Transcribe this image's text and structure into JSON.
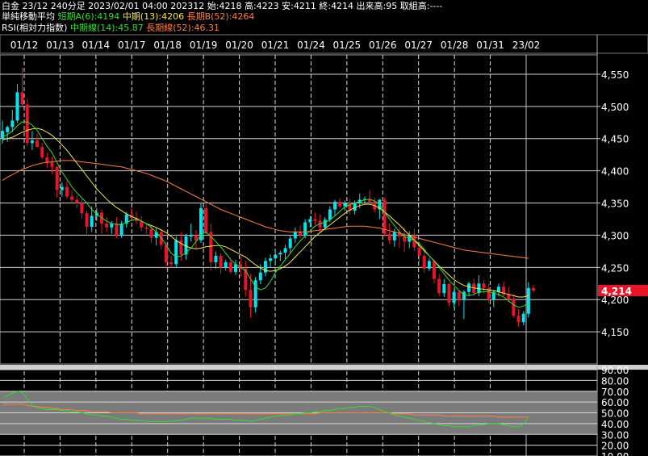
{
  "header": {
    "line1": "白金 23/12 240分足 2023/02/01 04:00 202312 始:4218 高:4223 安:4211 終:4214 出来高:95 取組高:----",
    "ma_title": "単純移動平均",
    "ma_short": "短期A(6):4194",
    "ma_mid": "中期(13):4206",
    "ma_long": "長期B(52):4264",
    "rsi_title": "RSI(相対力指数)",
    "rsi_mid": "中期線(14):45.87",
    "rsi_long": "長期線(52):46.31"
  },
  "colors": {
    "up": "#00e5f0",
    "down": "#e8142a",
    "ma_short": "#33dd33",
    "ma_mid": "#f2e94e",
    "ma_long": "#ff7f45",
    "rsi_mid": "#33dd33",
    "rsi_long": "#ff7f45",
    "price_tag": "#e8142a"
  },
  "chart_data": [
    {
      "type": "candlestick",
      "x_labels": [
        "01/12",
        "01/13",
        "01/14",
        "01/17",
        "01/18",
        "01/19",
        "01/20",
        "01/21",
        "01/24",
        "01/25",
        "01/26",
        "01/27",
        "01/28",
        "01/31",
        "23/02"
      ],
      "ylim": [
        4100,
        4580
      ],
      "y_ticks": [
        4150,
        4200,
        4250,
        4300,
        4350,
        4400,
        4450,
        4500,
        4550
      ],
      "y_tick_labels": [
        "4,150",
        "4,200",
        "4,250",
        "4,300",
        "4,350",
        "4,400",
        "4,450",
        "4,500",
        "4,550"
      ],
      "current_price": 4214,
      "current_price_label": "4,214",
      "candles": [
        [
          4450,
          4478,
          4442,
          4462
        ],
        [
          4460,
          4470,
          4445,
          4468
        ],
        [
          4468,
          4495,
          4460,
          4478
        ],
        [
          4478,
          4535,
          4474,
          4522
        ],
        [
          4522,
          4560,
          4500,
          4503
        ],
        [
          4503,
          4512,
          4438,
          4443
        ],
        [
          4443,
          4462,
          4432,
          4447
        ],
        [
          4447,
          4458,
          4440,
          4437
        ],
        [
          4437,
          4443,
          4418,
          4421
        ],
        [
          4421,
          4428,
          4404,
          4413
        ],
        [
          4413,
          4422,
          4395,
          4406
        ],
        [
          4406,
          4408,
          4358,
          4370
        ],
        [
          4370,
          4382,
          4360,
          4375
        ],
        [
          4375,
          4385,
          4356,
          4360
        ],
        [
          4360,
          4370,
          4350,
          4355
        ],
        [
          4355,
          4362,
          4342,
          4350
        ],
        [
          4350,
          4356,
          4326,
          4334
        ],
        [
          4334,
          4338,
          4300,
          4313
        ],
        [
          4313,
          4345,
          4305,
          4330
        ],
        [
          4330,
          4342,
          4322,
          4335
        ],
        [
          4335,
          4340,
          4302,
          4318
        ],
        [
          4318,
          4328,
          4305,
          4312
        ],
        [
          4312,
          4322,
          4302,
          4318
        ],
        [
          4318,
          4328,
          4295,
          4300
        ],
        [
          4300,
          4322,
          4296,
          4318
        ],
        [
          4318,
          4336,
          4312,
          4332
        ],
        [
          4332,
          4342,
          4322,
          4327
        ],
        [
          4327,
          4337,
          4318,
          4322
        ],
        [
          4322,
          4330,
          4306,
          4312
        ],
        [
          4312,
          4318,
          4302,
          4310
        ],
        [
          4310,
          4315,
          4288,
          4296
        ],
        [
          4296,
          4312,
          4284,
          4305
        ],
        [
          4305,
          4310,
          4278,
          4285
        ],
        [
          4285,
          4290,
          4247,
          4258
        ],
        [
          4258,
          4268,
          4250,
          4255
        ],
        [
          4255,
          4298,
          4250,
          4292
        ],
        [
          4292,
          4305,
          4260,
          4270
        ],
        [
          4270,
          4302,
          4262,
          4298
        ],
        [
          4298,
          4318,
          4290,
          4300
        ],
        [
          4300,
          4308,
          4278,
          4292
        ],
        [
          4292,
          4350,
          4288,
          4342
        ],
        [
          4342,
          4348,
          4300,
          4305
        ],
        [
          4305,
          4318,
          4245,
          4258
        ],
        [
          4258,
          4275,
          4248,
          4268
        ],
        [
          4268,
          4272,
          4240,
          4250
        ],
        [
          4250,
          4262,
          4245,
          4258
        ],
        [
          4258,
          4262,
          4240,
          4243
        ],
        [
          4243,
          4262,
          4238,
          4255
        ],
        [
          4255,
          4268,
          4235,
          4248
        ],
        [
          4248,
          4260,
          4205,
          4215
        ],
        [
          4215,
          4240,
          4172,
          4188
        ],
        [
          4188,
          4235,
          4180,
          4230
        ],
        [
          4230,
          4255,
          4224,
          4242
        ],
        [
          4242,
          4265,
          4236,
          4260
        ],
        [
          4260,
          4270,
          4250,
          4264
        ],
        [
          4264,
          4278,
          4255,
          4270
        ],
        [
          4270,
          4276,
          4260,
          4273
        ],
        [
          4273,
          4285,
          4262,
          4280
        ],
        [
          4280,
          4300,
          4272,
          4295
        ],
        [
          4295,
          4312,
          4288,
          4305
        ],
        [
          4305,
          4315,
          4295,
          4300
        ],
        [
          4300,
          4325,
          4295,
          4320
        ],
        [
          4320,
          4330,
          4312,
          4325
        ],
        [
          4325,
          4335,
          4316,
          4322
        ],
        [
          4322,
          4332,
          4305,
          4312
        ],
        [
          4312,
          4328,
          4308,
          4324
        ],
        [
          4324,
          4345,
          4320,
          4340
        ],
        [
          4340,
          4355,
          4330,
          4352
        ],
        [
          4352,
          4358,
          4342,
          4345
        ],
        [
          4345,
          4354,
          4338,
          4350
        ],
        [
          4350,
          4356,
          4332,
          4338
        ],
        [
          4338,
          4354,
          4332,
          4350
        ],
        [
          4350,
          4365,
          4342,
          4355
        ],
        [
          4355,
          4360,
          4350,
          4356
        ],
        [
          4356,
          4370,
          4350,
          4352
        ],
        [
          4352,
          4358,
          4335,
          4340
        ],
        [
          4340,
          4356,
          4325,
          4355
        ],
        [
          4355,
          4358,
          4298,
          4302
        ],
        [
          4302,
          4318,
          4286,
          4292
        ],
        [
          4292,
          4310,
          4282,
          4305
        ],
        [
          4305,
          4312,
          4280,
          4298
        ],
        [
          4298,
          4312,
          4274,
          4290
        ],
        [
          4290,
          4306,
          4280,
          4300
        ],
        [
          4300,
          4310,
          4275,
          4281
        ],
        [
          4281,
          4290,
          4258,
          4268
        ],
        [
          4268,
          4275,
          4242,
          4248
        ],
        [
          4248,
          4264,
          4244,
          4260
        ],
        [
          4260,
          4262,
          4225,
          4232
        ],
        [
          4232,
          4240,
          4205,
          4210
        ],
        [
          4210,
          4232,
          4204,
          4224
        ],
        [
          4224,
          4226,
          4190,
          4195
        ],
        [
          4195,
          4215,
          4188,
          4212
        ],
        [
          4212,
          4215,
          4190,
          4200
        ],
        [
          4200,
          4215,
          4170,
          4212
        ],
        [
          4212,
          4228,
          4205,
          4225
        ],
        [
          4225,
          4232,
          4206,
          4210
        ],
        [
          4210,
          4238,
          4205,
          4225
        ],
        [
          4225,
          4230,
          4210,
          4218
        ],
        [
          4218,
          4225,
          4195,
          4200
        ],
        [
          4200,
          4215,
          4188,
          4212
        ],
        [
          4212,
          4225,
          4205,
          4220
        ],
        [
          4220,
          4228,
          4205,
          4208
        ],
        [
          4208,
          4220,
          4196,
          4200
        ],
        [
          4200,
          4208,
          4172,
          4175
        ],
        [
          4175,
          4185,
          4158,
          4165
        ],
        [
          4165,
          4182,
          4160,
          4178
        ],
        [
          4178,
          4227,
          4172,
          4218
        ],
        [
          4218,
          4223,
          4211,
          4214
        ]
      ],
      "ma_short": [
        4452,
        4456,
        4462,
        4470,
        4476,
        4476,
        4471,
        4463,
        4450,
        4438,
        4428,
        4413,
        4398,
        4387,
        4375,
        4366,
        4358,
        4350,
        4340,
        4333,
        4327,
        4322,
        4318,
        4317,
        4316,
        4320,
        4323,
        4325,
        4322,
        4318,
        4312,
        4305,
        4296,
        4285,
        4272,
        4266,
        4268,
        4273,
        4280,
        4290,
        4300,
        4305,
        4298,
        4290,
        4282,
        4272,
        4262,
        4255,
        4250,
        4245,
        4232,
        4220,
        4215,
        4218,
        4228,
        4242,
        4252,
        4262,
        4272,
        4282,
        4291,
        4299,
        4307,
        4314,
        4318,
        4320,
        4324,
        4330,
        4337,
        4344,
        4347,
        4350,
        4352,
        4355,
        4356,
        4353,
        4348,
        4336,
        4325,
        4315,
        4305,
        4298,
        4295,
        4292,
        4287,
        4278,
        4268,
        4260,
        4250,
        4240,
        4230,
        4222,
        4214,
        4208,
        4206,
        4208,
        4212,
        4212,
        4212,
        4210,
        4208,
        4204,
        4198,
        4192,
        4188,
        4190,
        4194
      ],
      "ma_mid": [
        4448,
        4450,
        4452,
        4456,
        4460,
        4463,
        4465,
        4466,
        4464,
        4460,
        4455,
        4448,
        4440,
        4432,
        4422,
        4412,
        4402,
        4392,
        4382,
        4372,
        4364,
        4356,
        4349,
        4343,
        4338,
        4333,
        4329,
        4326,
        4322,
        4318,
        4315,
        4312,
        4308,
        4304,
        4298,
        4292,
        4287,
        4283,
        4280,
        4279,
        4280,
        4282,
        4283,
        4284,
        4284,
        4282,
        4278,
        4274,
        4270,
        4266,
        4260,
        4254,
        4249,
        4245,
        4244,
        4245,
        4248,
        4252,
        4258,
        4266,
        4274,
        4282,
        4290,
        4298,
        4304,
        4310,
        4316,
        4322,
        4328,
        4334,
        4339,
        4343,
        4346,
        4348,
        4348,
        4346,
        4342,
        4336,
        4330,
        4323,
        4316,
        4308,
        4300,
        4292,
        4284,
        4276,
        4268,
        4260,
        4252,
        4245,
        4238,
        4231,
        4226,
        4222,
        4220,
        4218,
        4217,
        4216,
        4215,
        4214,
        4212,
        4210,
        4208,
        4206,
        4204,
        4204,
        4206
      ],
      "ma_long": [
        4385,
        4390,
        4394,
        4398,
        4402,
        4405,
        4408,
        4410,
        4412,
        4413,
        4414,
        4415,
        4416,
        4416,
        4416,
        4415,
        4414,
        4413,
        4412,
        4411,
        4410,
        4409,
        4408,
        4407,
        4406,
        4404,
        4402,
        4400,
        4398,
        4396,
        4393,
        4390,
        4387,
        4384,
        4380,
        4376,
        4372,
        4368,
        4364,
        4360,
        4356,
        4352,
        4348,
        4344,
        4340,
        4337,
        4334,
        4331,
        4328,
        4325,
        4322,
        4319,
        4316,
        4313,
        4311,
        4309,
        4307,
        4306,
        4305,
        4305,
        4305,
        4305,
        4306,
        4307,
        4308,
        4309,
        4310,
        4311,
        4312,
        4313,
        4314,
        4314,
        4314,
        4314,
        4313,
        4312,
        4311,
        4309,
        4307,
        4305,
        4303,
        4301,
        4299,
        4297,
        4295,
        4293,
        4291,
        4289,
        4287,
        4285,
        4283,
        4281,
        4279,
        4277,
        4276,
        4275,
        4274,
        4273,
        4272,
        4271,
        4270,
        4269,
        4268,
        4267,
        4266,
        4265,
        4264
      ]
    },
    {
      "type": "line",
      "title": "RSI",
      "ylim": [
        10,
        90
      ],
      "y_ticks": [
        10,
        20,
        30,
        40,
        50,
        60,
        70,
        80,
        90
      ],
      "y_tick_labels": [
        "10.00",
        "20.00",
        "30.00",
        "40.00",
        "50.00",
        "60.00",
        "70.00",
        "80.00",
        "90.00"
      ],
      "series": [
        {
          "name": "中期線(14)",
          "values": [
            64,
            66,
            68,
            70,
            69,
            63,
            57,
            55,
            54,
            53,
            53,
            53,
            52,
            52,
            51,
            51,
            50,
            49,
            48,
            48,
            47,
            47,
            46,
            45,
            44,
            44,
            43,
            43,
            43,
            42,
            42,
            42,
            42,
            42,
            42,
            43,
            43,
            44,
            45,
            45,
            45,
            45,
            45,
            44,
            44,
            44,
            44,
            43,
            43,
            43,
            42,
            43,
            44,
            45,
            46,
            47,
            47,
            48,
            48,
            49,
            49,
            50,
            50,
            51,
            51,
            52,
            52,
            53,
            54,
            54,
            55,
            55,
            56,
            56,
            56,
            55,
            53,
            51,
            50,
            48,
            47,
            46,
            45,
            44,
            43,
            42,
            41,
            40,
            39,
            38,
            38,
            37,
            37,
            37,
            37,
            38,
            39,
            39,
            40,
            40,
            40,
            39,
            38,
            37,
            37,
            40,
            45.87
          ]
        },
        {
          "name": "長期線(52)",
          "values": [
            58,
            58,
            58,
            58,
            58,
            57,
            56,
            56,
            55,
            55,
            54,
            54,
            53,
            53,
            53,
            52,
            52,
            52,
            51,
            51,
            51,
            51,
            50,
            50,
            50,
            50,
            50,
            50,
            49,
            49,
            49,
            49,
            49,
            49,
            49,
            49,
            49,
            49,
            49,
            49,
            49,
            49,
            49,
            49,
            49,
            49,
            49,
            49,
            49,
            49,
            49,
            49,
            49,
            49,
            49,
            49,
            49,
            49,
            49,
            49,
            49,
            49,
            49,
            49,
            50,
            50,
            50,
            50,
            50,
            50,
            50,
            50,
            50,
            50,
            50,
            50,
            50,
            50,
            50,
            49,
            49,
            49,
            49,
            48,
            48,
            48,
            48,
            48,
            48,
            47,
            47,
            47,
            47,
            47,
            47,
            47,
            47,
            47,
            47,
            47,
            46,
            46,
            46,
            46,
            46,
            46,
            46.31
          ]
        }
      ]
    }
  ]
}
